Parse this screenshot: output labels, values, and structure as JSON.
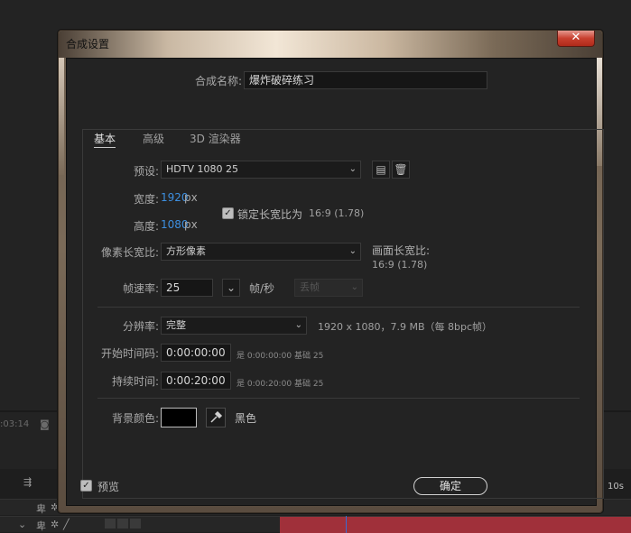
{
  "background": {
    "timecode": ":03:14",
    "time_mark": "10s"
  },
  "dialog": {
    "title": "合成设置",
    "close_glyph": "✕",
    "comp_name_label": "合成名称:",
    "comp_name_value": "爆炸破碎练习",
    "tabs": [
      "基本",
      "高级",
      "3D 渲染器"
    ],
    "preset_label": "预设:",
    "preset_value": "HDTV 1080 25",
    "width_label": "宽度:",
    "width_value": "1920",
    "width_unit": "px",
    "height_label": "高度:",
    "height_value": "1080",
    "height_unit": "px",
    "lock_ratio_label": "锁定长宽比为",
    "lock_ratio_value": "16:9 (1.78)",
    "pixel_aspect_label": "像素长宽比:",
    "pixel_aspect_value": "方形像素",
    "frame_aspect_label": "画面长宽比:",
    "frame_aspect_value": "16:9 (1.78)",
    "fps_label": "帧速率:",
    "fps_value": "25",
    "fps_unit": "帧/秒",
    "drop_frame_value": "丢帧",
    "resolution_label": "分辨率:",
    "resolution_value": "完整",
    "resolution_info": "1920 x 1080，7.9 MB（每 8bpc帧）",
    "start_tc_label": "开始时间码:",
    "start_tc_value": "0:00:00:00",
    "start_tc_info_is": "是 0:00:00:00",
    "start_tc_info_base": "基础 25",
    "duration_label": "持续时间:",
    "duration_value": "0:00:20:00",
    "duration_info_is": "是 0:00:20:00",
    "duration_info_base": "基础 25",
    "bg_color_label": "背景颜色:",
    "bg_color_name": "黑色",
    "bg_color_hex": "#000000",
    "preview_label": "预览",
    "ok_label": "确定"
  }
}
